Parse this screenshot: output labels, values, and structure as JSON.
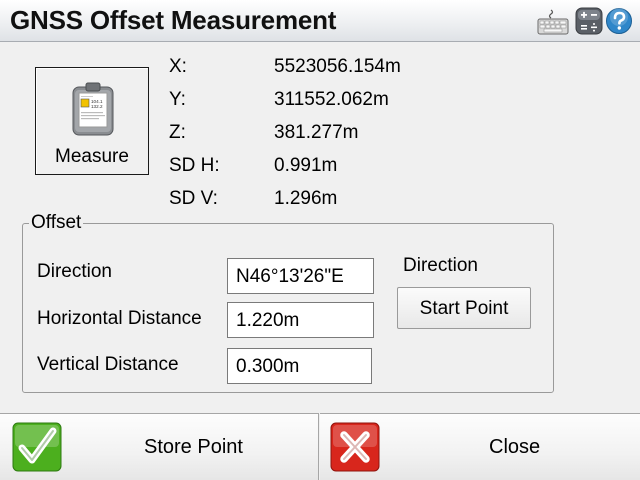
{
  "window": {
    "title": "GNSS Offset Measurement",
    "icons": [
      "keyboard-icon",
      "calculator-icon",
      "help-icon"
    ]
  },
  "measure": {
    "label": "Measure",
    "icon": "measure-icon",
    "icon_lines": [
      "104.1",
      "132.2"
    ]
  },
  "coordinates": [
    {
      "label": "X:",
      "value": "5523056.154m"
    },
    {
      "label": "Y:",
      "value": "311552.062m"
    },
    {
      "label": "Z:",
      "value": "381.277m"
    },
    {
      "label": "SD H:",
      "value": "0.991m"
    },
    {
      "label": "SD V:",
      "value": "1.296m"
    }
  ],
  "offset": {
    "legend": "Offset",
    "direction_label": "Direction",
    "direction_value": "N46°13'26\"E",
    "horizontal_label": "Horizontal Distance",
    "horizontal_value": "1.220m",
    "vertical_label": "Vertical Distance",
    "vertical_value": "0.300m",
    "direction_mode_label": "Direction",
    "start_point_label": "Start Point"
  },
  "footer": {
    "store_label": "Store Point",
    "store_icon": "checkmark-icon",
    "close_label": "Close",
    "close_icon": "x-icon"
  },
  "colors": {
    "check": "#4caf1e",
    "close": "#d8261c",
    "help": "#2f86c9"
  }
}
